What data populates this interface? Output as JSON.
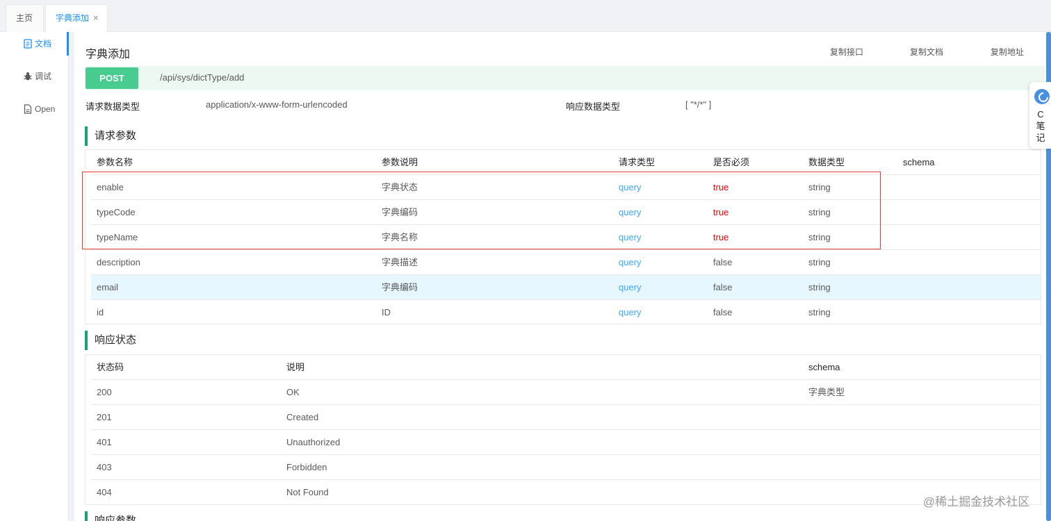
{
  "tabs": [
    {
      "label": "主页"
    },
    {
      "label": "字典添加",
      "close": "×"
    }
  ],
  "sidebar": {
    "items": [
      {
        "label": "文档"
      },
      {
        "label": "调试"
      },
      {
        "label": "Open"
      }
    ]
  },
  "header": {
    "title": "字典添加",
    "actions": [
      "复制接口",
      "复制文档",
      "复制地址"
    ]
  },
  "endpoint": {
    "method": "POST",
    "path": "/api/sys/dictType/add"
  },
  "meta": {
    "request_type_label": "请求数据类型",
    "request_type_value": "application/x-www-form-urlencoded",
    "response_type_label": "响应数据类型",
    "response_type_value": "[ \"*/*\" ]"
  },
  "request_params": {
    "section_title": "请求参数",
    "columns": [
      "参数名称",
      "参数说明",
      "请求类型",
      "是否必须",
      "数据类型",
      "schema"
    ],
    "rows": [
      {
        "name": "enable",
        "desc": "字典状态",
        "in": "query",
        "required": "true",
        "type": "string"
      },
      {
        "name": "typeCode",
        "desc": "字典编码",
        "in": "query",
        "required": "true",
        "type": "string"
      },
      {
        "name": "typeName",
        "desc": "字典名称",
        "in": "query",
        "required": "true",
        "type": "string"
      },
      {
        "name": "description",
        "desc": "字典描述",
        "in": "query",
        "required": "false",
        "type": "string"
      },
      {
        "name": "email",
        "desc": "字典编码",
        "in": "query",
        "required": "false",
        "type": "string"
      },
      {
        "name": "id",
        "desc": "ID",
        "in": "query",
        "required": "false",
        "type": "string"
      }
    ]
  },
  "response_status": {
    "section_title": "响应状态",
    "columns": [
      "状态码",
      "说明",
      "schema"
    ],
    "rows": [
      {
        "code": "200",
        "desc": "OK",
        "schema": "字典类型"
      },
      {
        "code": "201",
        "desc": "Created",
        "schema": ""
      },
      {
        "code": "401",
        "desc": "Unauthorized",
        "schema": ""
      },
      {
        "code": "403",
        "desc": "Forbidden",
        "schema": ""
      },
      {
        "code": "404",
        "desc": "Not Found",
        "schema": ""
      }
    ]
  },
  "response_params": {
    "section_title": "响应参数"
  },
  "note_widget": {
    "text": "C笔记"
  },
  "watermark": "@稀土掘金技术社区",
  "colors": {
    "accent": "#1890ff",
    "post": "#49cc90",
    "query": "#3ea6ff",
    "required": "#e60000",
    "section_bar": "#1aa076"
  }
}
